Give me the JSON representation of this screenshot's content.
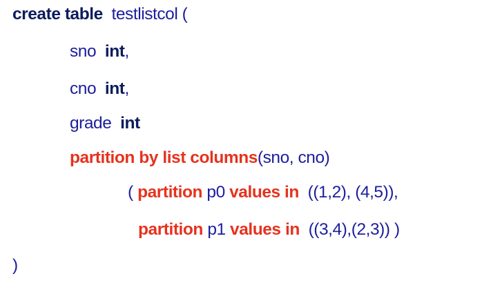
{
  "code": {
    "line1": {
      "kw": "create table",
      "text": "testlistcol ("
    },
    "line2": {
      "col": "sno",
      "type": "int",
      "punct": ","
    },
    "line3": {
      "col": "cno",
      "type": "int",
      "punct": ","
    },
    "line4": {
      "col": "grade",
      "type": "int"
    },
    "line5": {
      "kw": "partition by list columns",
      "args": "(sno, cno)"
    },
    "line6": {
      "open": "(",
      "kw1": "partition",
      "name": "p0",
      "kw2": "values in",
      "vals": "((1,2), (4,5)),"
    },
    "line7": {
      "kw1": "partition",
      "name": "p1",
      "kw2": "values in",
      "vals": "((3,4),(2,3)) )"
    },
    "line8": {
      "close": ")"
    }
  },
  "colors": {
    "keyword_navy": "#0c1c5c",
    "keyword_red": "#e6321e",
    "plain_text": "#1c1e9c"
  }
}
